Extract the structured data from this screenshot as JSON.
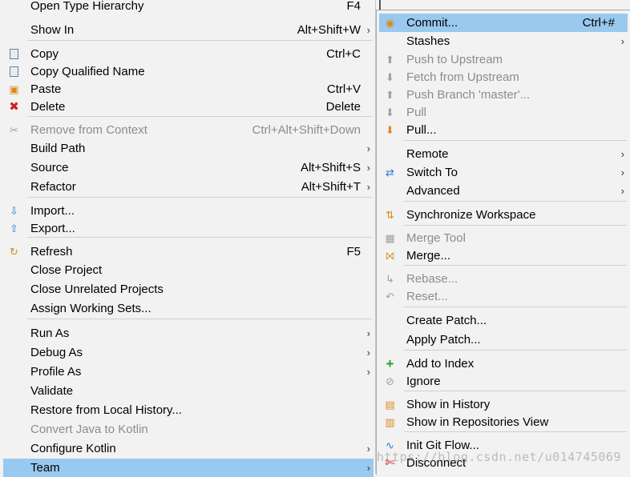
{
  "left_menu": {
    "items": [
      {
        "label": "Open Type Hierarchy",
        "accel": "F4",
        "icon": "",
        "disabled": false,
        "submenu": false
      },
      {
        "label": "Show In",
        "accel": "Alt+Shift+W",
        "icon": "",
        "disabled": false,
        "submenu": true
      },
      {
        "label": "Copy",
        "accel": "Ctrl+C",
        "icon": "copy-icon",
        "disabled": false,
        "submenu": false
      },
      {
        "label": "Copy Qualified Name",
        "accel": "",
        "icon": "copy-qualified-icon",
        "disabled": false,
        "submenu": false
      },
      {
        "label": "Paste",
        "accel": "Ctrl+V",
        "icon": "paste-icon",
        "disabled": false,
        "submenu": false
      },
      {
        "label": "Delete",
        "accel": "Delete",
        "icon": "delete-icon",
        "disabled": false,
        "submenu": false
      },
      {
        "label": "Remove from Context",
        "accel": "Ctrl+Alt+Shift+Down",
        "icon": "remove-context-icon",
        "disabled": true,
        "submenu": false
      },
      {
        "label": "Build Path",
        "accel": "",
        "icon": "",
        "disabled": false,
        "submenu": true
      },
      {
        "label": "Source",
        "accel": "Alt+Shift+S",
        "icon": "",
        "disabled": false,
        "submenu": true
      },
      {
        "label": "Refactor",
        "accel": "Alt+Shift+T",
        "icon": "",
        "disabled": false,
        "submenu": true
      },
      {
        "label": "Import...",
        "accel": "",
        "icon": "import-icon",
        "disabled": false,
        "submenu": false
      },
      {
        "label": "Export...",
        "accel": "",
        "icon": "export-icon",
        "disabled": false,
        "submenu": false
      },
      {
        "label": "Refresh",
        "accel": "F5",
        "icon": "refresh-icon",
        "disabled": false,
        "submenu": false
      },
      {
        "label": "Close Project",
        "accel": "",
        "icon": "",
        "disabled": false,
        "submenu": false
      },
      {
        "label": "Close Unrelated Projects",
        "accel": "",
        "icon": "",
        "disabled": false,
        "submenu": false
      },
      {
        "label": "Assign Working Sets...",
        "accel": "",
        "icon": "",
        "disabled": false,
        "submenu": false
      },
      {
        "label": "Run As",
        "accel": "",
        "icon": "",
        "disabled": false,
        "submenu": true
      },
      {
        "label": "Debug As",
        "accel": "",
        "icon": "",
        "disabled": false,
        "submenu": true
      },
      {
        "label": "Profile As",
        "accel": "",
        "icon": "",
        "disabled": false,
        "submenu": true
      },
      {
        "label": "Validate",
        "accel": "",
        "icon": "",
        "disabled": false,
        "submenu": false
      },
      {
        "label": "Restore from Local History...",
        "accel": "",
        "icon": "",
        "disabled": false,
        "submenu": false
      },
      {
        "label": "Convert Java to Kotlin",
        "accel": "",
        "icon": "",
        "disabled": true,
        "submenu": false
      },
      {
        "label": "Configure Kotlin",
        "accel": "",
        "icon": "",
        "disabled": false,
        "submenu": true
      },
      {
        "label": "Team",
        "accel": "",
        "icon": "",
        "disabled": false,
        "submenu": true,
        "selected": true
      }
    ]
  },
  "right_menu": {
    "items": [
      {
        "label": "Commit...",
        "accel": "Ctrl+#",
        "icon": "commit-icon",
        "disabled": false,
        "submenu": false,
        "selected": true
      },
      {
        "label": "Stashes",
        "accel": "",
        "icon": "",
        "disabled": false,
        "submenu": true
      },
      {
        "label": "Push to Upstream",
        "accel": "",
        "icon": "push-icon",
        "disabled": true,
        "submenu": false
      },
      {
        "label": "Fetch from Upstream",
        "accel": "",
        "icon": "fetch-icon",
        "disabled": true,
        "submenu": false
      },
      {
        "label": "Push Branch 'master'...",
        "accel": "",
        "icon": "push-branch-icon",
        "disabled": true,
        "submenu": false
      },
      {
        "label": "Pull",
        "accel": "",
        "icon": "pull-icon",
        "disabled": true,
        "submenu": false
      },
      {
        "label": "Pull...",
        "accel": "",
        "icon": "pull-dialog-icon",
        "disabled": false,
        "submenu": false
      },
      {
        "label": "Remote",
        "accel": "",
        "icon": "",
        "disabled": false,
        "submenu": true
      },
      {
        "label": "Switch To",
        "accel": "",
        "icon": "switch-icon",
        "disabled": false,
        "submenu": true
      },
      {
        "label": "Advanced",
        "accel": "",
        "icon": "",
        "disabled": false,
        "submenu": true
      },
      {
        "label": "Synchronize Workspace",
        "accel": "",
        "icon": "synchronize-icon",
        "disabled": false,
        "submenu": false
      },
      {
        "label": "Merge Tool",
        "accel": "",
        "icon": "merge-tool-icon",
        "disabled": true,
        "submenu": false
      },
      {
        "label": "Merge...",
        "accel": "",
        "icon": "merge-icon",
        "disabled": false,
        "submenu": false
      },
      {
        "label": "Rebase...",
        "accel": "",
        "icon": "rebase-icon",
        "disabled": true,
        "submenu": false
      },
      {
        "label": "Reset...",
        "accel": "",
        "icon": "reset-icon",
        "disabled": true,
        "submenu": false
      },
      {
        "label": "Create Patch...",
        "accel": "",
        "icon": "",
        "disabled": false,
        "submenu": false
      },
      {
        "label": "Apply Patch...",
        "accel": "",
        "icon": "",
        "disabled": false,
        "submenu": false
      },
      {
        "label": "Add to Index",
        "accel": "",
        "icon": "add-index-icon",
        "disabled": false,
        "submenu": false
      },
      {
        "label": "Ignore",
        "accel": "",
        "icon": "ignore-icon",
        "disabled": false,
        "submenu": false
      },
      {
        "label": "Show in History",
        "accel": "",
        "icon": "history-icon",
        "disabled": false,
        "submenu": false
      },
      {
        "label": "Show in Repositories View",
        "accel": "",
        "icon": "repositories-icon",
        "disabled": false,
        "submenu": false
      },
      {
        "label": "Init Git Flow...",
        "accel": "",
        "icon": "git-flow-icon",
        "disabled": false,
        "submenu": false
      },
      {
        "label": "Disconnect",
        "accel": "",
        "icon": "disconnect-icon",
        "disabled": false,
        "submenu": false
      }
    ]
  },
  "watermark": "https://blog.csdn.net/u014745069",
  "colors": {
    "selected": "#99c9ef",
    "background": "#f2f2f2",
    "disabled": "#8c8c8c"
  }
}
